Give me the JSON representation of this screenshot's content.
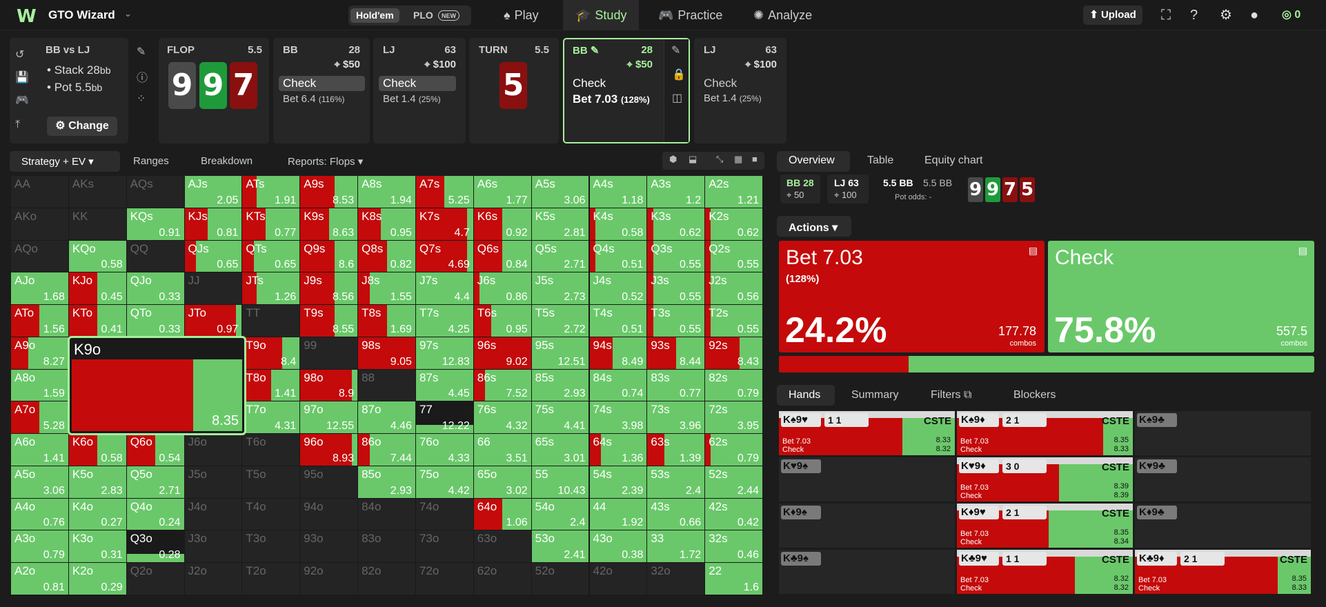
{
  "app": {
    "name": "GTO Wizard",
    "logo": "W",
    "games": [
      "Hold'em",
      "PLO"
    ],
    "new_badge": "NEW",
    "nav": [
      {
        "label": "Play",
        "icon": "spade-icon"
      },
      {
        "label": "Study",
        "icon": "graduation-cap-icon"
      },
      {
        "label": "Practice",
        "icon": "gamepad-icon"
      },
      {
        "label": "Analyze",
        "icon": "bulb-icon"
      }
    ],
    "upload": "Upload",
    "coins": "0"
  },
  "tree": {
    "spot": {
      "title": "BB vs LJ",
      "stack": "Stack 28",
      "pot": "Pot 5.5",
      "unit": "bb",
      "change": "Change"
    },
    "flop": {
      "label": "FLOP",
      "pot": "5.5",
      "cards": [
        {
          "r": "9",
          "c": "#4a4a4a"
        },
        {
          "r": "9",
          "c": "#1f9a3a"
        },
        {
          "r": "7",
          "c": "#8a1010"
        }
      ]
    },
    "bb1": {
      "label": "BB",
      "stack": "28",
      "pot": "$50",
      "check": "Check",
      "bet": "Bet 6.4",
      "pct": "(116%)"
    },
    "lj1": {
      "label": "LJ",
      "stack": "63",
      "pot": "$100",
      "check": "Check",
      "bet": "Bet 1.4",
      "pct": "(25%)"
    },
    "turn": {
      "label": "TURN",
      "pot": "5.5",
      "card": "5"
    },
    "bb2": {
      "label": "BB",
      "stack": "28",
      "pot": "$50",
      "check": "Check",
      "bet": "Bet 7.03",
      "pct": "(128%)"
    },
    "lj2": {
      "label": "LJ",
      "stack": "63",
      "pot": "$100",
      "check": "Check",
      "bet": "Bet 1.4",
      "pct": "(25%)"
    }
  },
  "left_tabs": [
    "Strategy + EV",
    "Ranges",
    "Breakdown",
    "Reports: Flops"
  ],
  "right_tabs": [
    "Overview",
    "Table",
    "Equity chart"
  ],
  "overview": {
    "bb": "BB 28",
    "bb_sub": "50",
    "lj": "LJ 63",
    "lj_sub": "100",
    "pot_bb": "5.5 BB",
    "pot2": "5.5 BB",
    "odds_label": "Pot odds:",
    "odds": "-",
    "board": [
      {
        "r": "9",
        "c": "#4a4a4a"
      },
      {
        "r": "9",
        "c": "#1f9a3a"
      },
      {
        "r": "7",
        "c": "#8a1010"
      },
      {
        "r": "5",
        "c": "#8a1010"
      }
    ]
  },
  "actions": {
    "label": "Actions",
    "bet": {
      "name": "Bet 7.03",
      "sub": "(128%)",
      "pct": "24.2%",
      "combos": "177.78",
      "unit": "combos"
    },
    "check": {
      "name": "Check",
      "pct": "75.8%",
      "combos": "557.5",
      "unit": "combos"
    },
    "bet_share": 0.242
  },
  "hands_tabs": [
    "Hands",
    "Summary",
    "Filters",
    "Blockers"
  ],
  "hover": {
    "hand": "K9o",
    "ev": "8.35",
    "bet_frac": 0.72
  },
  "grid": [
    [
      [
        "AA",
        "",
        -1
      ],
      [
        "AKs",
        "",
        -1
      ],
      [
        "AQs",
        "",
        -1
      ],
      [
        "AJs",
        "2.05",
        0
      ],
      [
        "ATs",
        "1.91",
        0.25
      ],
      [
        "A9s",
        "8.53",
        0.6
      ],
      [
        "A8s",
        "1.94",
        0
      ],
      [
        "A7s",
        "5.25",
        0.5
      ],
      [
        "A6s",
        "1.77",
        0
      ],
      [
        "A5s",
        "3.06",
        0
      ],
      [
        "A4s",
        "1.18",
        0
      ],
      [
        "A3s",
        "1.2",
        0
      ],
      [
        "A2s",
        "1.21",
        0
      ]
    ],
    [
      [
        "AKo",
        "",
        -1
      ],
      [
        "KK",
        "",
        -1
      ],
      [
        "KQs",
        "0.91",
        0
      ],
      [
        "KJs",
        "0.81",
        0.4
      ],
      [
        "KTs",
        "0.77",
        0.4
      ],
      [
        "K9s",
        "8.63",
        0.5
      ],
      [
        "K8s",
        "0.95",
        0.4
      ],
      [
        "K7s",
        "4.7",
        0.9
      ],
      [
        "K6s",
        "0.92",
        0.5
      ],
      [
        "K5s",
        "2.81",
        0
      ],
      [
        "K4s",
        "0.58",
        0.1
      ],
      [
        "K3s",
        "0.62",
        0.1
      ],
      [
        "K2s",
        "0.62",
        0.1
      ]
    ],
    [
      [
        "AQo",
        "",
        -1
      ],
      [
        "KQo",
        "0.58",
        0
      ],
      [
        "QQ",
        "",
        -1
      ],
      [
        "QJs",
        "0.65",
        0.2
      ],
      [
        "QTs",
        "0.65",
        0.2
      ],
      [
        "Q9s",
        "8.6",
        0.6
      ],
      [
        "Q8s",
        "0.82",
        0.5
      ],
      [
        "Q7s",
        "4.69",
        0.9
      ],
      [
        "Q6s",
        "0.84",
        0.5
      ],
      [
        "Q5s",
        "2.71",
        0
      ],
      [
        "Q4s",
        "0.51",
        0.1
      ],
      [
        "Q3s",
        "0.55",
        0.1
      ],
      [
        "Q2s",
        "0.55",
        0.1
      ]
    ],
    [
      [
        "AJo",
        "1.68",
        0
      ],
      [
        "KJo",
        "0.45",
        0.5
      ],
      [
        "QJo",
        "0.33",
        0
      ],
      [
        "JJ",
        "",
        -1
      ],
      [
        "JTs",
        "1.26",
        0.25
      ],
      [
        "J9s",
        "8.56",
        0.6
      ],
      [
        "J8s",
        "1.55",
        0.2
      ],
      [
        "J7s",
        "4.4",
        0
      ],
      [
        "J6s",
        "0.86",
        0.1
      ],
      [
        "J5s",
        "2.73",
        0
      ],
      [
        "J4s",
        "0.52",
        0
      ],
      [
        "J3s",
        "0.55",
        0.1
      ],
      [
        "J2s",
        "0.56",
        0.1
      ]
    ],
    [
      [
        "ATo",
        "1.56",
        0.5
      ],
      [
        "KTo",
        "0.41",
        0.5
      ],
      [
        "QTo",
        "0.33",
        0
      ],
      [
        "JTo",
        "0.97",
        0.9
      ],
      [
        "TT",
        "",
        -1
      ],
      [
        "T9s",
        "8.55",
        0.6
      ],
      [
        "T8s",
        "1.69",
        0.5
      ],
      [
        "T7s",
        "4.25",
        0
      ],
      [
        "T6s",
        "0.95",
        0.3
      ],
      [
        "T5s",
        "2.72",
        0
      ],
      [
        "T4s",
        "0.51",
        0
      ],
      [
        "T3s",
        "0.55",
        0.1
      ],
      [
        "T2s",
        "0.55",
        0.1
      ]
    ],
    [
      [
        "A9o",
        "8.27",
        0.3
      ],
      [
        "K9o",
        "8.35",
        0.7
      ],
      [
        "Q9o",
        "8.35",
        0.7
      ],
      [
        "J9o",
        "8.4",
        0.7
      ],
      [
        "T9o",
        "8.4",
        0.7
      ],
      [
        "99",
        "",
        -1
      ],
      [
        "98s",
        "9.05",
        1
      ],
      [
        "97s",
        "12.83",
        0
      ],
      [
        "96s",
        "9.02",
        1
      ],
      [
        "95s",
        "12.51",
        0
      ],
      [
        "94s",
        "8.49",
        0.4
      ],
      [
        "93s",
        "8.44",
        0.5
      ],
      [
        "92s",
        "8.43",
        0.6
      ]
    ],
    [
      [
        "A8o",
        "1.59",
        0
      ],
      [
        "K8o",
        "",
        -1
      ],
      [
        "Q8o",
        "",
        -1
      ],
      [
        "J8o",
        "",
        -1
      ],
      [
        "T8o",
        "1.41",
        0.5
      ],
      [
        "98o",
        "8.9",
        0.9
      ],
      [
        "88",
        "",
        -1
      ],
      [
        "87s",
        "4.45",
        0
      ],
      [
        "86s",
        "7.52",
        0.2
      ],
      [
        "85s",
        "2.93",
        0
      ],
      [
        "84s",
        "0.74",
        0
      ],
      [
        "83s",
        "0.77",
        0
      ],
      [
        "82s",
        "0.79",
        0
      ]
    ],
    [
      [
        "A7o",
        "5.28",
        0.5
      ],
      [
        "K7o",
        "",
        -1
      ],
      [
        "Q7o",
        "",
        -1
      ],
      [
        "J7o",
        "",
        -1
      ],
      [
        "T7o",
        "4.31",
        0
      ],
      [
        "97o",
        "12.55",
        0
      ],
      [
        "87o",
        "4.46",
        0
      ],
      [
        "77",
        "12.22",
        -2
      ],
      [
        "76s",
        "4.32",
        0
      ],
      [
        "75s",
        "4.41",
        0
      ],
      [
        "74s",
        "3.98",
        0
      ],
      [
        "73s",
        "3.96",
        0
      ],
      [
        "72s",
        "3.95",
        0
      ]
    ],
    [
      [
        "A6o",
        "1.41",
        0
      ],
      [
        "K6o",
        "0.58",
        0.5
      ],
      [
        "Q6o",
        "0.54",
        0.5
      ],
      [
        "J6o",
        "",
        -1
      ],
      [
        "T6o",
        "",
        -1
      ],
      [
        "96o",
        "8.93",
        0.9
      ],
      [
        "86o",
        "7.44",
        0.2
      ],
      [
        "76o",
        "4.33",
        0
      ],
      [
        "66",
        "3.51",
        0
      ],
      [
        "65s",
        "3.01",
        0
      ],
      [
        "64s",
        "1.36",
        0.2
      ],
      [
        "63s",
        "1.39",
        0.3
      ],
      [
        "62s",
        "0.79",
        0.1
      ]
    ],
    [
      [
        "A5o",
        "3.06",
        0
      ],
      [
        "K5o",
        "2.83",
        0
      ],
      [
        "Q5o",
        "2.71",
        0
      ],
      [
        "J5o",
        "",
        -1
      ],
      [
        "T5o",
        "",
        -1
      ],
      [
        "95o",
        "",
        -1
      ],
      [
        "85o",
        "2.93",
        0
      ],
      [
        "75o",
        "4.42",
        0
      ],
      [
        "65o",
        "3.02",
        0
      ],
      [
        "55",
        "10.43",
        0
      ],
      [
        "54s",
        "2.39",
        0
      ],
      [
        "53s",
        "2.4",
        0
      ],
      [
        "52s",
        "2.44",
        0
      ]
    ],
    [
      [
        "A4o",
        "0.76",
        0
      ],
      [
        "K4o",
        "0.27",
        0
      ],
      [
        "Q4o",
        "0.24",
        0
      ],
      [
        "J4o",
        "",
        -1
      ],
      [
        "T4o",
        "",
        -1
      ],
      [
        "94o",
        "",
        -1
      ],
      [
        "84o",
        "",
        -1
      ],
      [
        "74o",
        "",
        -1
      ],
      [
        "64o",
        "1.06",
        0.5
      ],
      [
        "54o",
        "2.4",
        0
      ],
      [
        "44",
        "1.92",
        0
      ],
      [
        "43s",
        "0.66",
        0
      ],
      [
        "42s",
        "0.42",
        0
      ]
    ],
    [
      [
        "A3o",
        "0.79",
        0
      ],
      [
        "K3o",
        "0.31",
        0
      ],
      [
        "Q3o",
        "0.28",
        -2
      ],
      [
        "J3o",
        "",
        -1
      ],
      [
        "T3o",
        "",
        -1
      ],
      [
        "93o",
        "",
        -1
      ],
      [
        "83o",
        "",
        -1
      ],
      [
        "73o",
        "",
        -1
      ],
      [
        "63o",
        "",
        -1
      ],
      [
        "53o",
        "2.41",
        0
      ],
      [
        "43o",
        "0.38",
        0
      ],
      [
        "33",
        "1.72",
        0
      ],
      [
        "32s",
        "0.46",
        0
      ]
    ],
    [
      [
        "A2o",
        "0.81",
        0
      ],
      [
        "K2o",
        "0.29",
        0
      ],
      [
        "Q2o",
        "",
        -1
      ],
      [
        "J2o",
        "",
        -1
      ],
      [
        "T2o",
        "",
        -1
      ],
      [
        "92o",
        "",
        -1
      ],
      [
        "82o",
        "",
        -1
      ],
      [
        "72o",
        "",
        -1
      ],
      [
        "62o",
        "",
        -1
      ],
      [
        "52o",
        "",
        -1
      ],
      [
        "42o",
        "",
        -1
      ],
      [
        "32o",
        "",
        -1
      ],
      [
        "22",
        "1.6",
        0
      ]
    ]
  ],
  "hands": [
    {
      "combo": "K♠9♥",
      "blk": "1 1",
      "bet": 0.7,
      "ev1": "8.33",
      "ev2": "8.32",
      "a1": "Bet 7.03",
      "a2": "Check"
    },
    {
      "combo": "K♠9♦",
      "blk": "2 1",
      "bet": 0.83,
      "ev1": "8.35",
      "ev2": "8.33",
      "a1": "Bet 7.03",
      "a2": "Check"
    },
    {
      "combo": "K♠9♣",
      "blk": "",
      "bet": -1
    },
    {
      "combo": "K♥9♠",
      "blk": "",
      "bet": -1
    },
    {
      "combo": "K♥9♦",
      "blk": "3 0",
      "bet": 0.58,
      "ev1": "8.39",
      "ev2": "8.39",
      "a1": "Bet 7.03",
      "a2": "Check"
    },
    {
      "combo": "K♥9♣",
      "blk": "",
      "bet": -1
    },
    {
      "combo": "K♦9♠",
      "blk": "",
      "bet": -1
    },
    {
      "combo": "K♦9♥",
      "blk": "2 1",
      "bet": 0.52,
      "ev1": "8.35",
      "ev2": "8.34",
      "a1": "Bet 7.03",
      "a2": "Check"
    },
    {
      "combo": "K♦9♣",
      "blk": "",
      "bet": -1
    },
    {
      "combo": "K♣9♠",
      "blk": "",
      "bet": -1
    },
    {
      "combo": "K♣9♥",
      "blk": "1 1",
      "bet": 0.67,
      "ev1": "8.32",
      "ev2": "8.32",
      "a1": "Bet 7.03",
      "a2": "Check"
    },
    {
      "combo": "K♣9♦",
      "blk": "2 1",
      "bet": 0.81,
      "ev1": "8.35",
      "ev2": "8.33",
      "a1": "Bet 7.03",
      "a2": "Check"
    }
  ],
  "colors": {
    "bet": "#c40a0a",
    "check": "#6ac86a",
    "empty": "#242424",
    "accent": "#a6f09c"
  }
}
